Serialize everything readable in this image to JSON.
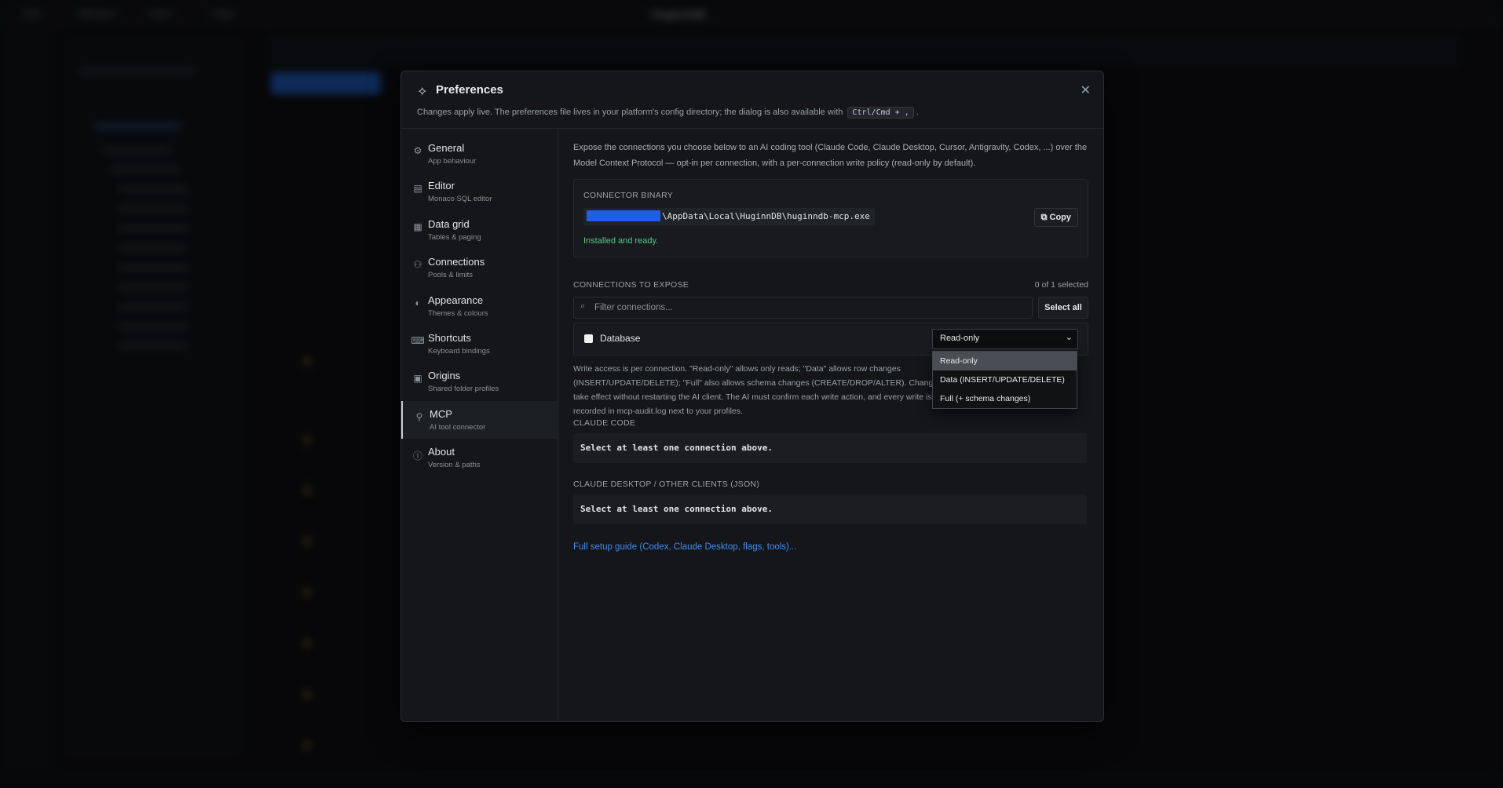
{
  "colors": {
    "accent": "#3d8ef5",
    "success": "#4ecb8a",
    "dialog_bg": "#141619"
  },
  "dialog": {
    "title": "Preferences",
    "title_icon": "sparkle-icon",
    "subtitle_pre": "Changes apply live. The preferences file lives in your platform's config directory; the dialog is also available with",
    "shortcut": "Ctrl/Cmd + ,",
    "subtitle_post": "."
  },
  "nav": [
    {
      "label": "General",
      "desc": "App behaviour",
      "icon": "gear-icon",
      "glyph": "⚙"
    },
    {
      "label": "Editor",
      "desc": "Monaco SQL editor",
      "icon": "file-icon",
      "glyph": "▤"
    },
    {
      "label": "Data grid",
      "desc": "Tables & paging",
      "icon": "table-icon",
      "glyph": "▦"
    },
    {
      "label": "Connections",
      "desc": "Pools & limits",
      "icon": "network-icon",
      "glyph": "⚇"
    },
    {
      "label": "Appearance",
      "desc": "Themes & colours",
      "icon": "palette-icon",
      "glyph": "◐"
    },
    {
      "label": "Shortcuts",
      "desc": "Keyboard bindings",
      "icon": "keyboard-icon",
      "glyph": "⌨"
    },
    {
      "label": "Origins",
      "desc": "Shared folder profiles",
      "icon": "folder-icon",
      "glyph": "▣"
    },
    {
      "label": "MCP",
      "desc": "AI tool connector",
      "icon": "plug-icon",
      "glyph": "⚲"
    },
    {
      "label": "About",
      "desc": "Version & paths",
      "icon": "info-icon",
      "glyph": "ⓘ"
    }
  ],
  "active_nav": "MCP",
  "mcp": {
    "intro": "Expose the connections you choose below to an AI coding tool (Claude Code, Claude Desktop, Cursor, Antigravity, Codex, ...) over the Model Context Protocol — opt-in per connection, with a per-connection write policy (read-only by default).",
    "binary_label": "CONNECTOR BINARY",
    "binary_path": "\\AppData\\Local\\HuginnDB\\huginndb-mcp.exe",
    "copy_label": "Copy",
    "installed_text": "Installed and ready.",
    "connections_label": "CONNECTIONS TO EXPOSE",
    "selected_count": "0 of 1 selected",
    "filter_placeholder": "Filter connections...",
    "select_all_label": "Select all",
    "connection_name": "Database",
    "policy_value": "Read-only",
    "help_text": "Write access is per connection. \"Read-only\" allows only reads; \"Data\" allows row changes (INSERT/UPDATE/DELETE); \"Full\" also allows schema changes (CREATE/DROP/ALTER). Changes take effect without restarting the AI client. The AI must confirm each write action, and every write is recorded in mcp-audit.log next to your profiles.",
    "claude_code_label": "CLAUDE CODE",
    "claude_code_text": "Select at least one connection above.",
    "desktop_label": "CLAUDE DESKTOP / OTHER CLIENTS (JSON)",
    "desktop_text": "Select at least one connection above.",
    "guide_link": "Full setup guide (Codex, Claude Desktop, flags, tools)..."
  },
  "policy_options": [
    "Read-only",
    "Data (INSERT/UPDATE/DELETE)",
    "Full (+ schema changes)"
  ],
  "bg": {
    "menu": [
      "File",
      "Window",
      "View",
      "Help"
    ],
    "app_title": "HuginnDB"
  }
}
